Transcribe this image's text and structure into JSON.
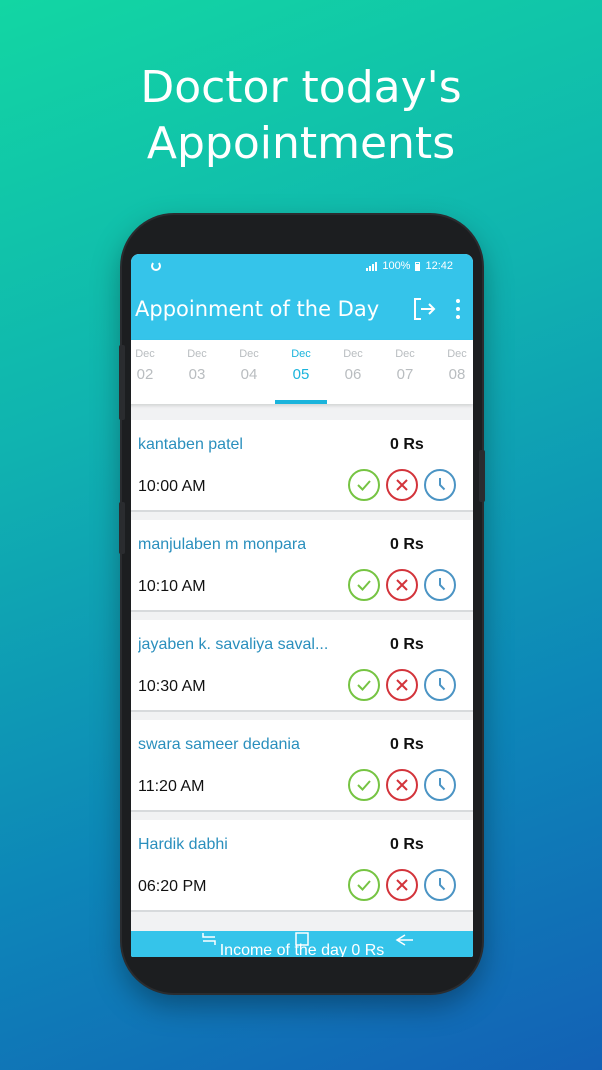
{
  "headline": {
    "line1": "Doctor today's",
    "line2": "Appointments"
  },
  "status_bar": {
    "battery": "100%",
    "time": "12:42"
  },
  "app_bar": {
    "title": "Appoinment of the Day",
    "logout_icon": "logout-icon",
    "menu_icon": "more-vert-icon"
  },
  "dates": [
    {
      "month": "Dec",
      "day": "02"
    },
    {
      "month": "Dec",
      "day": "03"
    },
    {
      "month": "Dec",
      "day": "04"
    },
    {
      "month": "Dec",
      "day": "05",
      "active": true
    },
    {
      "month": "Dec",
      "day": "06"
    },
    {
      "month": "Dec",
      "day": "07"
    },
    {
      "month": "Dec",
      "day": "08"
    }
  ],
  "appointments": [
    {
      "name": "kantaben patel",
      "fee": "0 Rs",
      "time": "10:00 AM"
    },
    {
      "name": "manjulaben m monpara",
      "fee": "0 Rs",
      "time": "10:10 AM"
    },
    {
      "name": "jayaben k. savaliya saval...",
      "fee": "0 Rs",
      "time": "10:30 AM"
    },
    {
      "name": "swara sameer dedania",
      "fee": "0 Rs",
      "time": "11:20 AM"
    },
    {
      "name": "Hardik dabhi",
      "fee": "0 Rs",
      "time": "06:20 PM"
    }
  ],
  "footer": {
    "income_label": "Income of the day 0 Rs"
  },
  "colors": {
    "accent": "#35c4ea",
    "name_text": "#2a8fbd",
    "approve": "#76c443",
    "reject": "#d3343b",
    "reschedule": "#4b94c4"
  }
}
